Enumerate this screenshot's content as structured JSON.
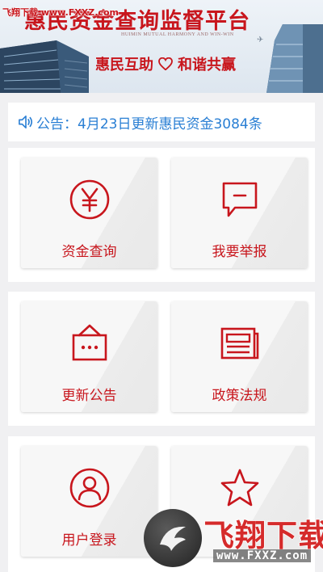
{
  "banner": {
    "watermark_top": "飞翔下载 www.FXXZ.com",
    "title": "惠民资金查询监督平台",
    "subtitle_en": "HUIMIN MUTUAL HARMONY AND WIN-WIN",
    "slogan_left": "惠民互助",
    "slogan_right": "和谐共赢"
  },
  "notice": {
    "icon": "speaker-icon",
    "text": "公告：4月23日更新惠民资金3084条"
  },
  "menu": [
    {
      "label": "资金查询",
      "icon": "yuan-icon"
    },
    {
      "label": "我要举报",
      "icon": "message-icon"
    },
    {
      "label": "更新公告",
      "icon": "notice-board-icon"
    },
    {
      "label": "政策法规",
      "icon": "newspaper-icon"
    },
    {
      "label": "用户登录",
      "icon": "user-icon"
    },
    {
      "label": "",
      "icon": "star-icon"
    }
  ],
  "watermark": {
    "text": "飞翔下载",
    "url": "www.FXXZ.com"
  },
  "colors": {
    "accent": "#c8161d",
    "notice_blue": "#2a7fd4",
    "background": "#f0f0f2"
  }
}
